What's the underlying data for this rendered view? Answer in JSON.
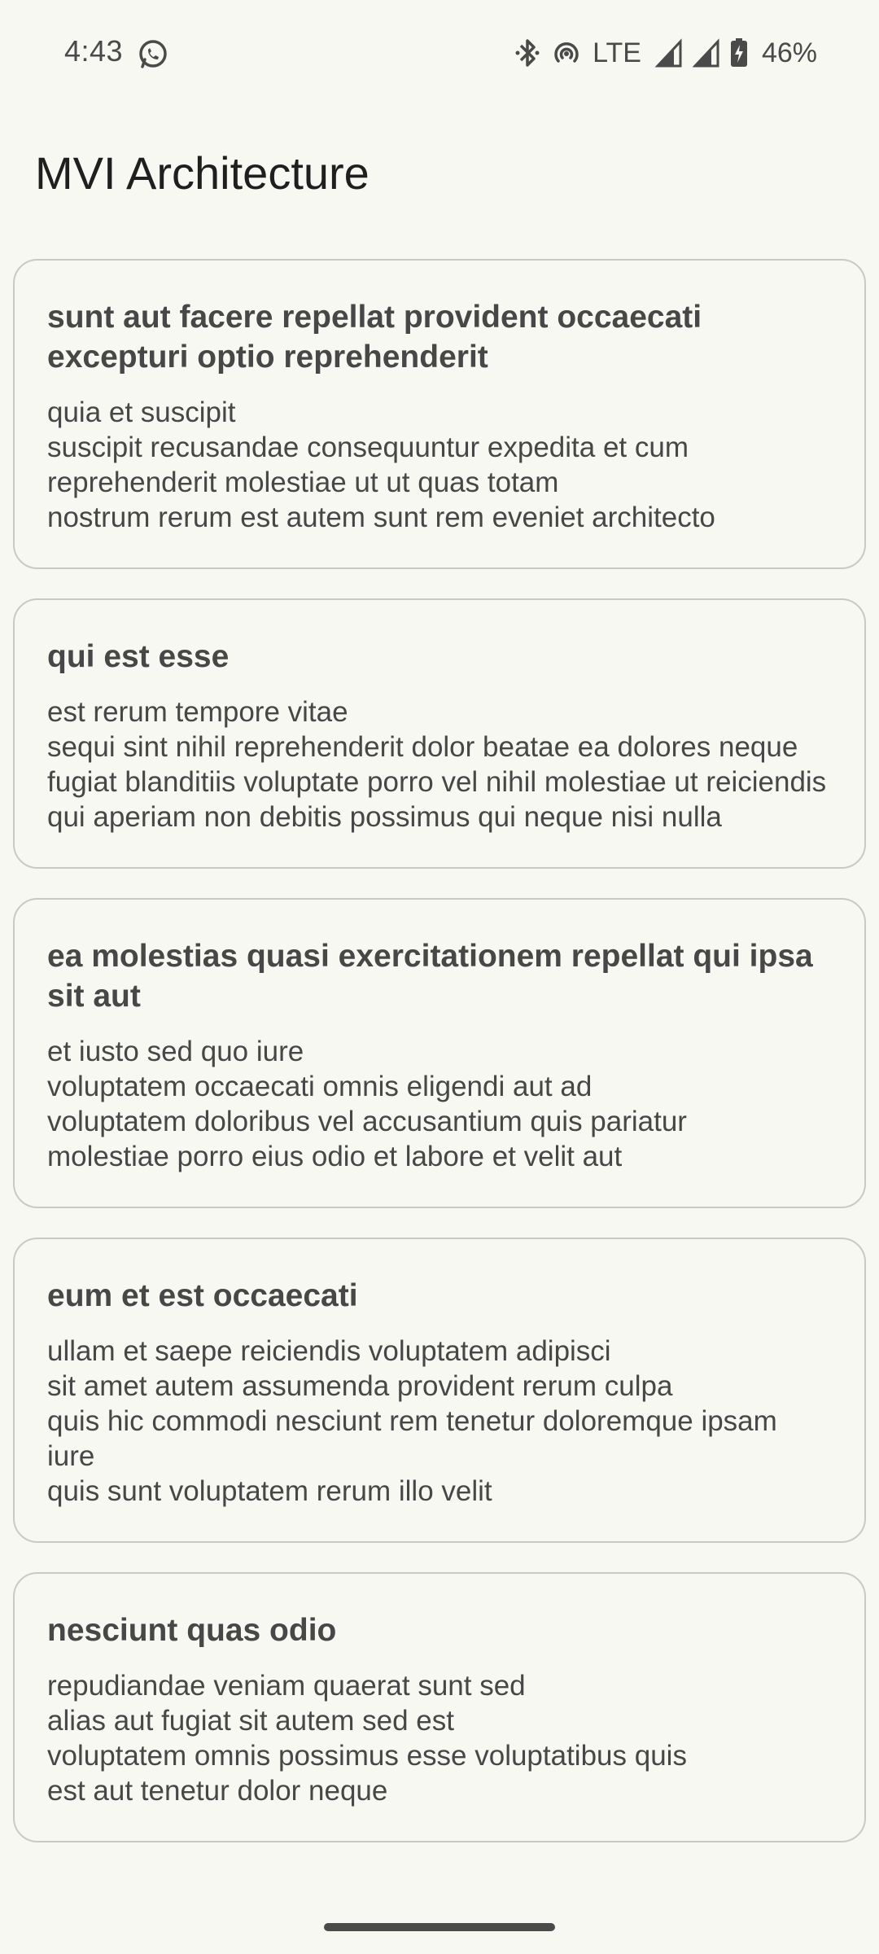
{
  "status_bar": {
    "time": "4:43",
    "network": "LTE",
    "battery": "46%",
    "icons": [
      "whatsapp-icon",
      "bluetooth-icon",
      "hotspot-icon",
      "signal-icon",
      "signal-icon",
      "battery-charging-icon"
    ]
  },
  "app": {
    "title": "MVI Architecture"
  },
  "posts": [
    {
      "title": "sunt aut facere repellat provident occaecati excepturi optio reprehenderit",
      "body_lines": [
        "quia et suscipit",
        "suscipit recusandae consequuntur expedita et cum",
        "reprehenderit molestiae ut ut quas totam",
        "nostrum rerum est autem sunt rem eveniet architecto"
      ]
    },
    {
      "title": "qui est esse",
      "body_lines": [
        "est rerum tempore vitae",
        "sequi sint nihil reprehenderit dolor beatae ea dolores neque",
        "fugiat blanditiis voluptate porro vel nihil molestiae ut reiciendis",
        "qui aperiam non debitis possimus qui neque nisi nulla"
      ]
    },
    {
      "title": "ea molestias quasi exercitationem repellat qui ipsa sit aut",
      "body_lines": [
        "et iusto sed quo iure",
        "voluptatem occaecati omnis eligendi aut ad",
        "voluptatem doloribus vel accusantium quis pariatur",
        "molestiae porro eius odio et labore et velit aut"
      ]
    },
    {
      "title": "eum et est occaecati",
      "body_lines": [
        "ullam et saepe reiciendis voluptatem adipisci",
        "sit amet autem assumenda provident rerum culpa",
        "quis hic commodi nesciunt rem tenetur doloremque ipsam iure",
        "quis sunt voluptatem rerum illo velit"
      ]
    },
    {
      "title": "nesciunt quas odio",
      "body_lines": [
        "repudiandae veniam quaerat sunt sed",
        "alias aut fugiat sit autem sed est",
        "voluptatem omnis possimus esse voluptatibus quis",
        "est aut tenetur dolor neque"
      ]
    }
  ]
}
